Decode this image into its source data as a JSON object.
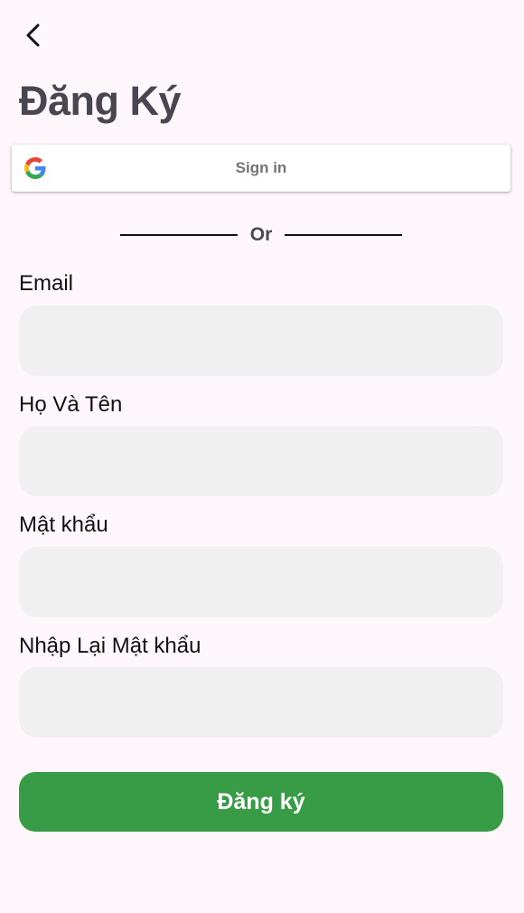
{
  "header": {
    "back_icon": "chevron-left-icon",
    "title": "Đăng Ký"
  },
  "google": {
    "icon": "google-icon",
    "label": "Sign in"
  },
  "divider": {
    "text": "Or"
  },
  "form": {
    "fields": [
      {
        "label": "Email",
        "value": "",
        "placeholder": ""
      },
      {
        "label": "Họ Và Tên",
        "value": "",
        "placeholder": ""
      },
      {
        "label": "Mật khẩu",
        "value": "",
        "placeholder": ""
      },
      {
        "label": "Nhập Lại Mật khẩu",
        "value": "",
        "placeholder": ""
      }
    ],
    "submit_label": "Đăng ký"
  },
  "colors": {
    "background": "#fdf7fb",
    "title": "#484650",
    "input_bg": "#f0f0f0",
    "submit_bg": "#389c46"
  }
}
